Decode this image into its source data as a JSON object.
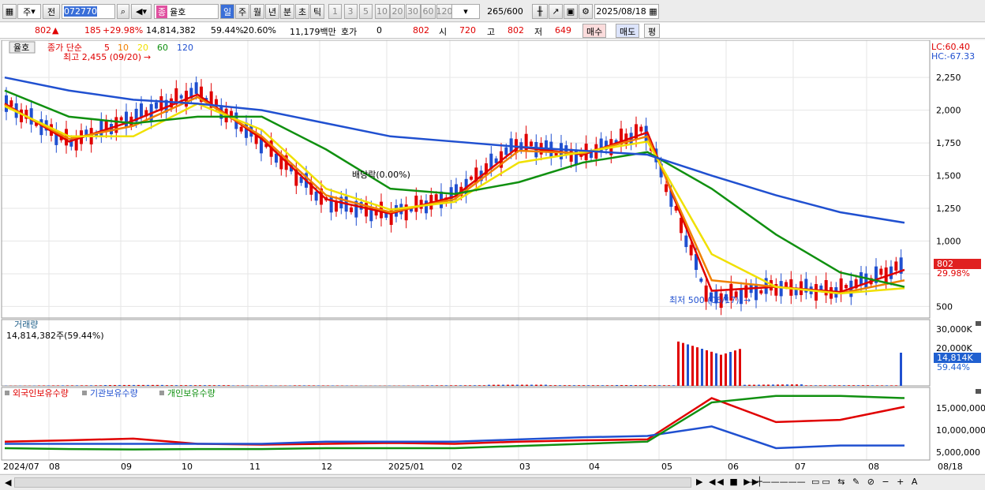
{
  "toolbar": {
    "code": "072770",
    "name": "율호",
    "stock_kind": "주",
    "prev": "전",
    "stock_tag": "종",
    "periods": [
      "일",
      "주",
      "월",
      "년",
      "분",
      "초",
      "틱"
    ],
    "intervals": [
      "1",
      "3",
      "5",
      "10",
      "20",
      "30",
      "60",
      "120"
    ],
    "count": "265",
    "count_max": "/600",
    "date": "2025/08/18"
  },
  "info": {
    "price": "802",
    "change": "185",
    "change_pct": "+29.98%",
    "volume": "14,814,382",
    "vol_ratio": "59.44%",
    "turnover": "20.60%",
    "amount": "11,179백만",
    "hoga_label": "호가",
    "hoga_value": "0",
    "hoga_price": "802",
    "open_label": "시",
    "open": "720",
    "high_label": "고",
    "high": "802",
    "low_label": "저",
    "low": "649",
    "buy": "매수",
    "sell": "매도",
    "avg": "평"
  },
  "price_panel": {
    "title_tag": "율호",
    "legend": [
      {
        "label": "종가 단순",
        "color": "#e00000"
      },
      {
        "label": "5",
        "color": "#e00000"
      },
      {
        "label": "10",
        "color": "#f08000"
      },
      {
        "label": "20",
        "color": "#f0e000"
      },
      {
        "label": "60",
        "color": "#109010"
      },
      {
        "label": "120",
        "color": "#2050d0"
      }
    ],
    "high_note": "최고 2,455 (09/20)",
    "low_note": "최저 500 (06/17)",
    "dividend_note": "배당락(0.00%)",
    "lc": "LC:60.40",
    "hc": "HC:-67.33",
    "y_ticks": [
      "2,250",
      "2,000",
      "1,750",
      "1,500",
      "1,250",
      "1,000",
      "500"
    ],
    "last_price": "802",
    "last_pct": "29.98%"
  },
  "volume_panel": {
    "title": "거래량",
    "value": "14,814,382주(59.44%)",
    "y_ticks": [
      "30,000K",
      "20,000K"
    ],
    "last": "14,814K",
    "last_pct": "59.44%"
  },
  "holdings_panel": {
    "legend": [
      {
        "label": "외국인보유수량",
        "color": "#e00000"
      },
      {
        "label": "기관보유수량",
        "color": "#2050d0"
      },
      {
        "label": "개인보유수량",
        "color": "#109010"
      }
    ],
    "y_ticks": [
      "15,000,000",
      "10,000,000",
      "5,000,000"
    ]
  },
  "x_axis": [
    "2024/07",
    "08",
    "09",
    "10",
    "11",
    "12",
    "2025/01",
    "02",
    "03",
    "04",
    "05",
    "06",
    "07",
    "08",
    "08/18"
  ],
  "chart_data": {
    "type": "line",
    "title": "율호",
    "x": [
      "2024/07",
      "2024/08",
      "2024/09",
      "2024/10",
      "2024/11",
      "2024/12",
      "2025/01",
      "2025/02",
      "2025/03",
      "2025/04",
      "2025/05",
      "2025/06",
      "2025/07",
      "2025/08",
      "2025/08/18"
    ],
    "series": [
      {
        "name": "종가",
        "values": [
          2050,
          1750,
          1950,
          2150,
          1750,
          1300,
          1200,
          1350,
          1750,
          1650,
          1850,
          550,
          650,
          620,
          802
        ]
      },
      {
        "name": "5",
        "values": [
          2050,
          1760,
          1920,
          2120,
          1780,
          1320,
          1210,
          1340,
          1720,
          1660,
          1830,
          620,
          650,
          610,
          780
        ]
      },
      {
        "name": "10",
        "values": [
          2040,
          1780,
          1880,
          2100,
          1800,
          1350,
          1220,
          1320,
          1690,
          1670,
          1800,
          700,
          650,
          600,
          700
        ]
      },
      {
        "name": "20",
        "values": [
          2030,
          1800,
          1800,
          2050,
          1850,
          1400,
          1240,
          1300,
          1600,
          1680,
          1760,
          900,
          650,
          600,
          640
        ]
      },
      {
        "name": "60",
        "values": [
          2150,
          1950,
          1900,
          1950,
          1950,
          1700,
          1400,
          1360,
          1450,
          1600,
          1680,
          1400,
          1050,
          760,
          650
        ]
      },
      {
        "name": "120",
        "values": [
          2250,
          2150,
          2080,
          2050,
          2000,
          1900,
          1800,
          1760,
          1720,
          1690,
          1660,
          1500,
          1350,
          1220,
          1140
        ]
      }
    ],
    "volume_k": [
      200,
      300,
      400,
      300,
      200,
      300,
      200,
      300,
      500,
      300,
      400,
      30000,
      800,
      300,
      14814
    ],
    "holdings": {
      "외국인보유수량": [
        6500000,
        6800000,
        7200000,
        6000000,
        5800000,
        6000000,
        6200000,
        6000000,
        6500000,
        6800000,
        7000000,
        16500000,
        11000000,
        11500000,
        14500000
      ],
      "기관보유수량": [
        6000000,
        6000000,
        6000000,
        6000000,
        6000000,
        6500000,
        6500000,
        6500000,
        7000000,
        7500000,
        7800000,
        10000000,
        5000000,
        5600000,
        5600000
      ],
      "개인보유수량": [
        5000000,
        4800000,
        4700000,
        4800000,
        4800000,
        5000000,
        5000000,
        5000000,
        5500000,
        6000000,
        6500000,
        15500000,
        17000000,
        17000000,
        16500000
      ]
    },
    "ylim": [
      400,
      2450
    ]
  }
}
